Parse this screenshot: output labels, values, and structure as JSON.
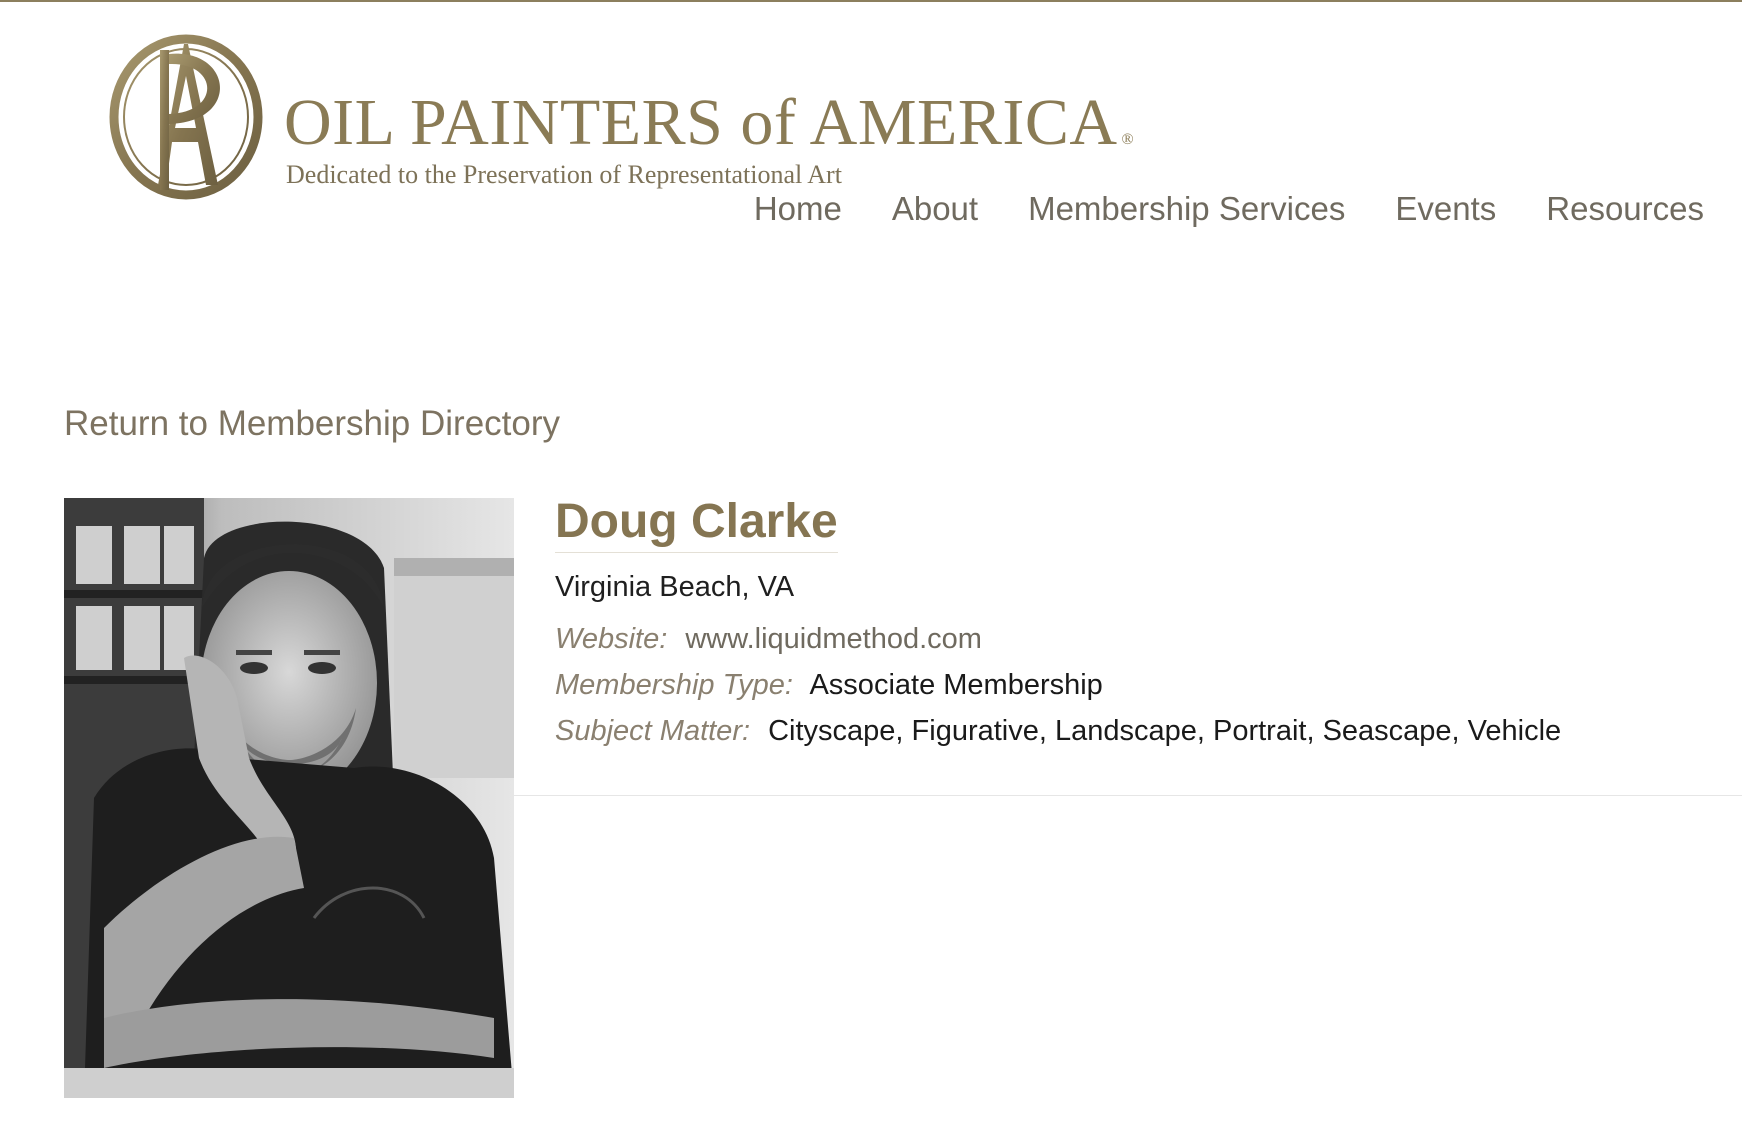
{
  "brand": {
    "name": "OIL PAINTERS of AMERICA",
    "registered_mark": "®",
    "tagline": "Dedicated to the Preservation of Representational Art",
    "color": "#8a7b55"
  },
  "nav": {
    "items": [
      {
        "label": "Home"
      },
      {
        "label": "About"
      },
      {
        "label": "Membership Services"
      },
      {
        "label": "Events"
      },
      {
        "label": "Resources"
      }
    ]
  },
  "back_link": {
    "label": "Return to Membership Directory"
  },
  "member": {
    "name": "Doug Clarke",
    "location": "Virginia Beach, VA",
    "website_label": "Website:",
    "website": "www.liquidmethod.com",
    "membership_type_label": "Membership Type:",
    "membership_type": "Associate Membership",
    "subject_matter_label": "Subject Matter:",
    "subject_matter": "Cityscape, Figurative, Landscape, Portrait, Seascape, Vehicle"
  },
  "icons": {
    "logo": "opa-monogram-icon"
  }
}
